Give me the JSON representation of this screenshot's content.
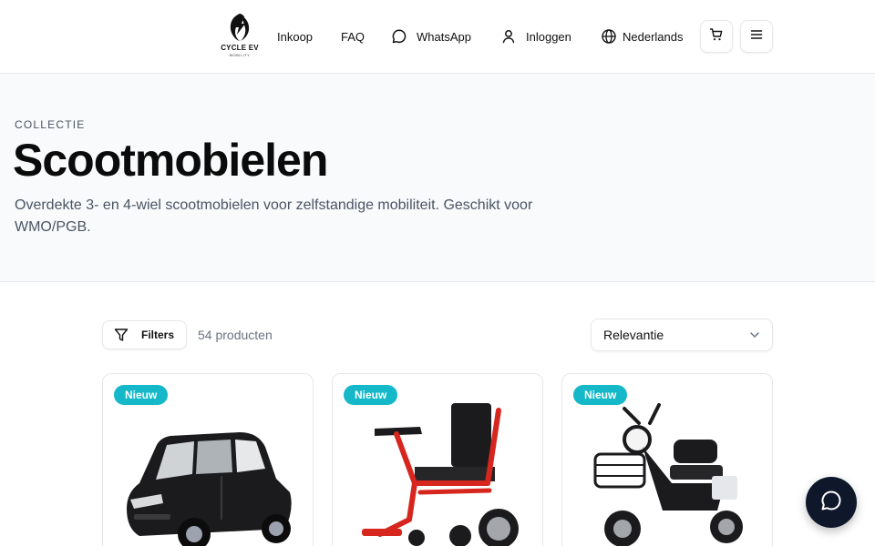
{
  "header": {
    "logo": {
      "text": "CYCLE EV",
      "subtext": "MOBILITY",
      "icon": "lightning-logo-icon"
    },
    "nav": [
      {
        "label": "Inkoop"
      },
      {
        "label": "FAQ"
      },
      {
        "label": "WhatsApp",
        "icon": "chat-bubble-icon"
      },
      {
        "label": "Inloggen",
        "icon": "user-icon"
      },
      {
        "label": "Nederlands",
        "icon": "globe-icon"
      }
    ],
    "cart_icon": "cart-icon",
    "menu_icon": "menu-icon"
  },
  "hero": {
    "eyebrow": "COLLECTIE",
    "title": "Scootmobielen",
    "description": "Overdekte 3- en 4-wiel scootmobielen voor zelfstandige mobiliteit. Geschikt voor WMO/PGB."
  },
  "toolbar": {
    "filters_label": "Filters",
    "product_count": "54 producten",
    "sort_value": "Relevantie"
  },
  "products": [
    {
      "badge": "Nieuw",
      "image": "enclosed-mobility-car"
    },
    {
      "badge": "Nieuw",
      "image": "folding-electric-wheelchair"
    },
    {
      "badge": "Nieuw",
      "image": "three-wheel-scooter"
    }
  ],
  "colors": {
    "badge": "#14b8c8",
    "hero_bg": "#f8fafc",
    "chat_button": "#0f172a",
    "wheelchair_frame": "#d7261e"
  }
}
